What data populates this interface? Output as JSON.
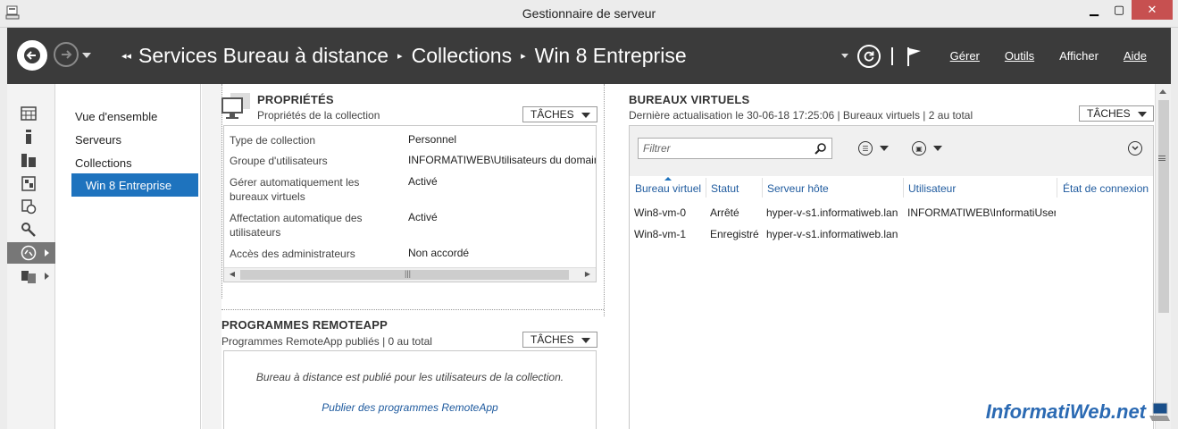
{
  "window": {
    "title": "Gestionnaire de serveur"
  },
  "header": {
    "breadcrumb": [
      "Services Bureau à distance",
      "Collections",
      "Win 8 Entreprise"
    ],
    "menu": [
      "Gérer",
      "Outils",
      "Afficher",
      "Aide"
    ]
  },
  "nav": {
    "items": [
      "Vue d'ensemble",
      "Serveurs",
      "Collections"
    ],
    "selected": "Win 8 Entreprise"
  },
  "properties": {
    "title": "PROPRIÉTÉS",
    "subtitle": "Propriétés de la collection",
    "tasks_label": "TÂCHES",
    "rows": [
      {
        "label": "Type de collection",
        "value": "Personnel"
      },
      {
        "label": "Groupe d'utilisateurs",
        "value": "INFORMATIWEB\\Utilisateurs du domaine"
      },
      {
        "label": "Gérer automatiquement les bureaux virtuels",
        "value": "Activé"
      },
      {
        "label": "Affectation automatique des utilisateurs",
        "value": "Activé"
      },
      {
        "label": "Accès des administrateurs",
        "value": "Non accordé"
      }
    ]
  },
  "remoteapp": {
    "title": "PROGRAMMES REMOTEAPP",
    "subtitle": "Programmes RemoteApp publiés | 0 au total",
    "tasks_label": "TÂCHES",
    "message": "Bureau à distance est publié pour les utilisateurs de la collection.",
    "link": "Publier des programmes RemoteApp"
  },
  "virtual_desktops": {
    "title": "BUREAUX VIRTUELS",
    "subtitle": "Dernière actualisation le 30-06-18 17:25:06 | Bureaux virtuels  | 2 au total",
    "tasks_label": "TÂCHES",
    "filter_placeholder": "Filtrer",
    "columns": [
      "Bureau virtuel",
      "Statut",
      "Serveur hôte",
      "Utilisateur",
      "État de connexion"
    ],
    "rows": [
      [
        "Win8-vm-0",
        "Arrêté",
        "hyper-v-s1.informatiweb.lan",
        "INFORMATIWEB\\InformatiUser",
        ""
      ],
      [
        "Win8-vm-1",
        "Enregistré",
        "hyper-v-s1.informatiweb.lan",
        "",
        ""
      ]
    ]
  },
  "watermark": "InformatiWeb.net",
  "colors": {
    "header_bg": "#3b3b3b",
    "selection": "#1e73be",
    "link": "#1e5a9e"
  }
}
